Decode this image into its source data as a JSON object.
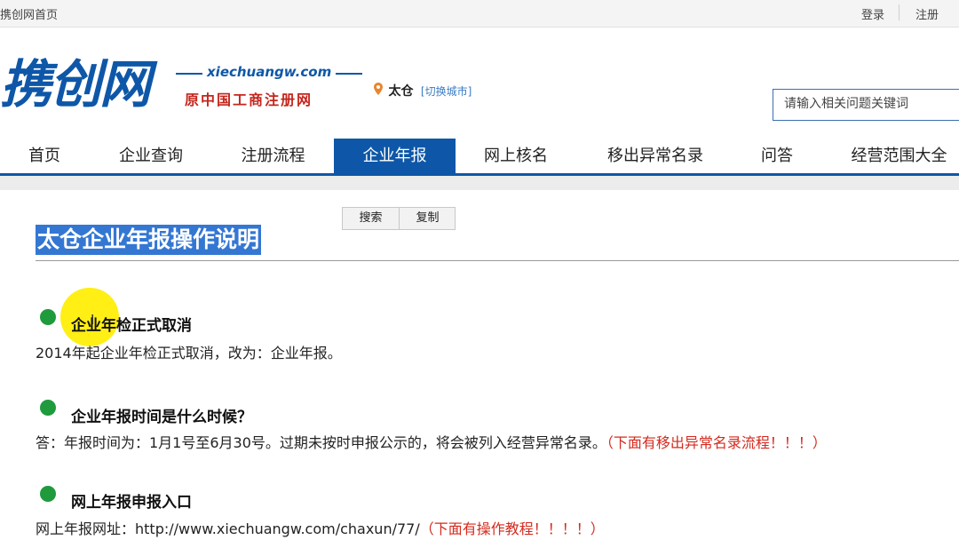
{
  "topbar": {
    "home": "携创网首页",
    "login": "登录",
    "register": "注册"
  },
  "header": {
    "logo": "携创网",
    "url": "xiechuangw.com",
    "subtitle": "原中国工商注册网",
    "city": "太仓",
    "switch_city": "[切换城市]",
    "search_placeholder": "请输入相关问题关键词"
  },
  "nav": {
    "items": [
      "首页",
      "企业查询",
      "注册流程",
      "企业年报",
      "网上核名",
      "移出异常名录",
      "问答",
      "经营范围大全"
    ],
    "active_index": 3
  },
  "tools": {
    "search": "搜索",
    "copy": "复制"
  },
  "article": {
    "title": "太仓企业年报操作说明",
    "sections": [
      {
        "heading": "企业年检正式取消",
        "body": "2014年起企业年检正式取消，改为：企业年报。",
        "note": ""
      },
      {
        "heading": "企业年报时间是什么时候？",
        "body": "答：年报时间为：1月1号至6月30号。过期未按时申报公示的，将会被列入经营异常名录。",
        "note": "（下面有移出异常名录流程！！！）"
      },
      {
        "heading": "网上年报申报入口",
        "body": "网上年报网址：http://www.xiechuangw.com/chaxun/77/",
        "note": "（下面有操作教程！！！！）"
      }
    ]
  },
  "colors": {
    "brand_blue": "#0e57a8",
    "brand_red": "#c4261d",
    "bullet_green": "#1f9a3c",
    "note_red": "#d42a1e",
    "selection_blue": "#3477d3"
  },
  "icons": {
    "city": "map-pin-icon",
    "bullet": "green-dot-icon"
  }
}
